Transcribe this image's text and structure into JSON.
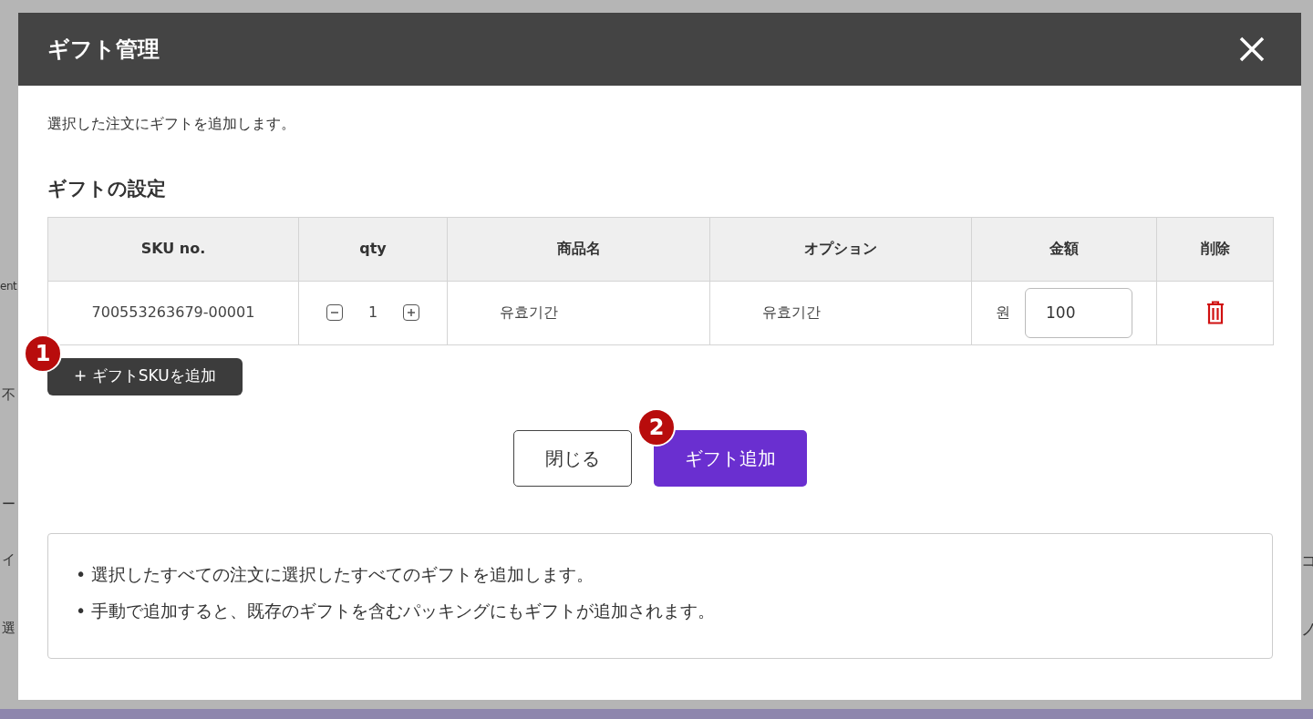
{
  "background_left_texts": [
    "ent",
    "不",
    "ー",
    "イ",
    "選"
  ],
  "background_right_texts": [
    "コ",
    "ノ"
  ],
  "dialog": {
    "title": "ギフト管理",
    "description": "選択した注文にギフトを追加します。",
    "section_title": "ギフトの設定",
    "table": {
      "columns": [
        "SKU no.",
        "qty",
        "商品名",
        "オプション",
        "金額",
        "削除"
      ],
      "rows": [
        {
          "sku": "700553263679-00001",
          "qty": "1",
          "product_name": "유효기간",
          "option": "유효기간",
          "currency": "원",
          "amount": "100"
        }
      ]
    },
    "add_sku_button": {
      "label": "+ ギフトSKUを追加",
      "callout": "1"
    },
    "buttons": [
      {
        "label": "閉じる",
        "kind": "secondary"
      },
      {
        "label": "ギフト追加",
        "kind": "primary",
        "callout": "2"
      }
    ],
    "notes": [
      "• 選択したすべての注文に選択したすべてのギフトを追加します。",
      "• 手動で追加すると、既存のギフトを含むパッキングにもギフトが追加されます。"
    ]
  }
}
